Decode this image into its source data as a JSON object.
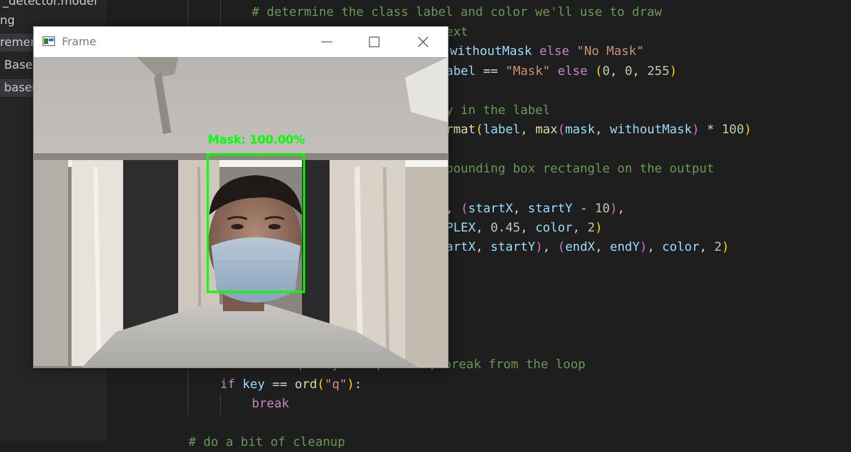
{
  "explorer": {
    "items": [
      {
        "label": "_detector.model",
        "selected": false
      },
      {
        "label": "ng",
        "selected": false
      },
      {
        "label": "remen",
        "selected": true
      },
      {
        "label": "Based",
        "selected": false
      },
      {
        "label": "basec",
        "selected": true
      }
    ]
  },
  "editor": {
    "lines": {
      "l1_comment": "# determine the class label and color we'll use to draw",
      "l2_comment": "ext",
      "l3_var": "withoutMask",
      "l3_else": "else",
      "l3_str": "\"No Mask\"",
      "l4_var": "abel",
      "l4_op": "==",
      "l4_str": "\"Mask\"",
      "l4_else": "else",
      "l4_n1": "0",
      "l4_n2": "0",
      "l4_n3": "255",
      "l5_comment": "y in the label",
      "l6_fn_tail": "rmat",
      "l6_label": "label",
      "l6_max": "max",
      "l6_mask": "mask",
      "l6_without": "withoutMask",
      "l6_num": "100",
      "l7_comment": "bounding box rectangle on the output",
      "l8_startX": "startX",
      "l8_startY": "startY",
      "l8_num": "10",
      "l9_tail": "PLEX",
      "l9_num1": "0.45",
      "l9_color": "color",
      "l9_num2": "2",
      "l10_startX": "artX",
      "l10_startY": "startY",
      "l10_endX": "endX",
      "l10_endY": "endY",
      "l10_color": "color",
      "l10_num": "2",
      "l11_comment": "# if the `q` key was pressed, break from the loop",
      "l12_if": "if",
      "l12_key": "key",
      "l12_ord": "ord",
      "l12_str": "\"q\"",
      "l13_break": "break",
      "l14_comment": "# do a bit of cleanup"
    }
  },
  "frame_window": {
    "title": "Frame",
    "detection_label": "Mask: 100.00%",
    "detection_color": "#00ff00",
    "buttons": {
      "minimize": "minimize",
      "maximize": "maximize",
      "close": "close"
    }
  },
  "colors": {
    "editor_bg": "#1e1e1e",
    "sidebar_bg": "#252526",
    "comment": "#6a9955",
    "keyword": "#c586c0",
    "string": "#ce9178",
    "variable": "#9cdcfe",
    "function": "#dcdcaa",
    "number": "#b5cea8"
  }
}
